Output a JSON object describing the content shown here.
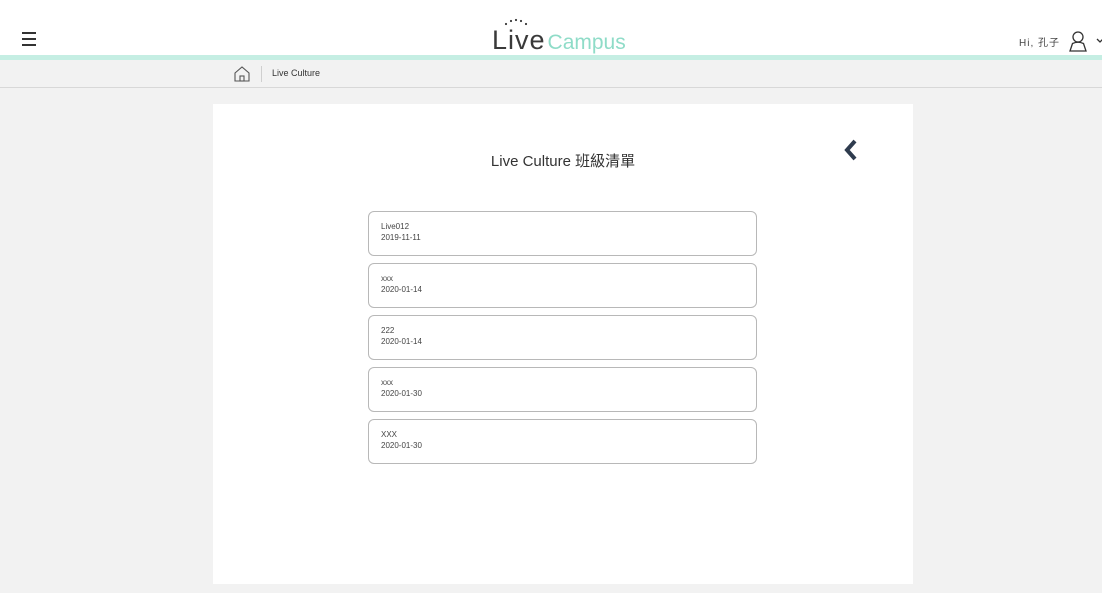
{
  "header": {
    "logo_live": "Live",
    "logo_campus": "Campus",
    "greeting": "Hi, 孔子",
    "accent_color": "#8fdcc8",
    "line_color": "#c5eee3"
  },
  "breadcrumb": {
    "current": "Live Culture"
  },
  "panel": {
    "title": "Live Culture 班級清單"
  },
  "classes": [
    {
      "name": "Live012",
      "date": "2019-11-11"
    },
    {
      "name": "xxx",
      "date": "2020-01-14"
    },
    {
      "name": "222",
      "date": "2020-01-14"
    },
    {
      "name": "xxx",
      "date": "2020-01-30"
    },
    {
      "name": "XXX",
      "date": "2020-01-30"
    }
  ],
  "icons": {
    "menu": "hamburger-menu-icon",
    "user": "user-icon",
    "home": "home-icon",
    "back": "chevron-left-icon",
    "dropdown": "chevron-down-icon"
  }
}
